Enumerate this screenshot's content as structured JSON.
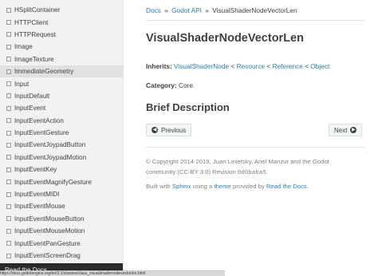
{
  "sidebar": {
    "items": [
      {
        "label": "HSplitContainer"
      },
      {
        "label": "HTTPClient"
      },
      {
        "label": "HTTPRequest"
      },
      {
        "label": "Image"
      },
      {
        "label": "ImageTexture"
      },
      {
        "label": "ImmediateGeometry",
        "selected": true
      },
      {
        "label": "Input"
      },
      {
        "label": "InputDefault"
      },
      {
        "label": "InputEvent"
      },
      {
        "label": "InputEventAction"
      },
      {
        "label": "InputEventGesture"
      },
      {
        "label": "InputEventJoypadButton"
      },
      {
        "label": "InputEventJoypadMotion"
      },
      {
        "label": "InputEventKey"
      },
      {
        "label": "InputEventMagnifyGesture"
      },
      {
        "label": "InputEventMIDI"
      },
      {
        "label": "InputEventMouse"
      },
      {
        "label": "InputEventMouseButton"
      },
      {
        "label": "InputEventMouseMotion"
      },
      {
        "label": "InputEventPanGesture"
      },
      {
        "label": "InputEventScreenDrag"
      }
    ],
    "rtd_label": "Read the Docs"
  },
  "breadcrumb": {
    "docs": "Docs",
    "sep": "»",
    "api": "Godot API",
    "current": "VisualShaderNodeVectorLen"
  },
  "page": {
    "title": "VisualShaderNodeVectorLen",
    "inherits_label": "Inherits:",
    "inherits": [
      "VisualShaderNode",
      "Resource",
      "Reference",
      "Object"
    ],
    "inherits_sep": "<",
    "category_label": "Category:",
    "category": "Core",
    "brief_heading": "Brief Description"
  },
  "buttons": {
    "previous": "Previous",
    "next": "Next"
  },
  "footer": {
    "copyright": "© Copyright 2014-2019, Juan Linietsky, Ariel Manzur and the Godot community (CC-BY 3.0) Revision",
    "revision": "0d0baba5",
    "revision_suffix": ".",
    "built_with": "Built with",
    "sphinx": "Sphinx",
    "using_a": "using a",
    "theme": "theme",
    "provided_by": "provided by",
    "rtd": "Read the Docs",
    "period": "."
  },
  "status": {
    "url": "https://docs.godotengine.org/en/3.1/classes/class_visualshadernodevectorlen.html"
  },
  "colors": {
    "link": "#2980b9",
    "text": "#404040",
    "sidebar_bg": "#f2f2f2"
  }
}
